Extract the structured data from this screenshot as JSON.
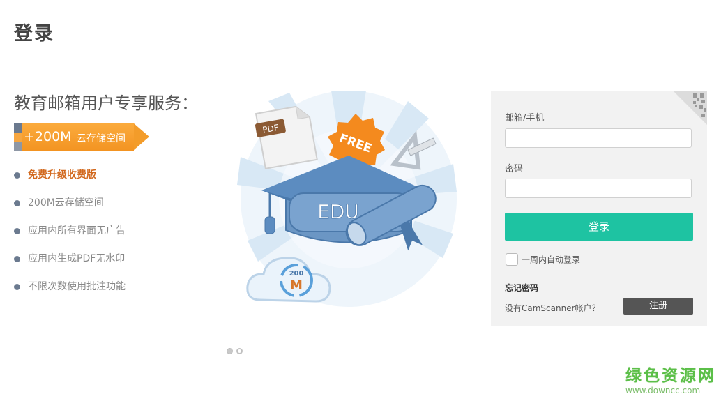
{
  "header": {
    "title": "登录"
  },
  "promo": {
    "heading": "教育邮箱用户专享服务：",
    "ribbon": {
      "amount": "+200M",
      "label": "云存储空间"
    },
    "features": [
      {
        "label": "免费升级收费版",
        "highlight": true
      },
      {
        "label": "200M云存储空间",
        "highlight": false
      },
      {
        "label": "应用内所有界面无广告",
        "highlight": false
      },
      {
        "label": "应用内生成PDF无水印",
        "highlight": false
      },
      {
        "label": "不限次数使用批注功能",
        "highlight": false
      }
    ],
    "illustration": {
      "pdf_label": "PDF",
      "free_label": "FREE",
      "edu_label": "EDU",
      "cloud_number": "200",
      "cloud_letter": "M"
    },
    "carousel": {
      "count": 2,
      "active_index": 1
    }
  },
  "login": {
    "account_label": "邮箱/手机",
    "account_value": "",
    "password_label": "密码",
    "password_value": "",
    "submit_label": "登录",
    "remember_label": "一周内自动登录",
    "remember_checked": false,
    "forgot_label": "忘记密码",
    "no_account_text": "没有CamScanner帐户？",
    "register_label": "注册"
  },
  "watermark": {
    "title": "绿色资源网",
    "url": "www.downcc.com"
  },
  "colors": {
    "accent_green": "#1ec3a2",
    "ribbon_orange": "#f39c2a",
    "highlight_text": "#d2691e",
    "register_button": "#555555",
    "panel_bg": "#f2f2f2"
  }
}
